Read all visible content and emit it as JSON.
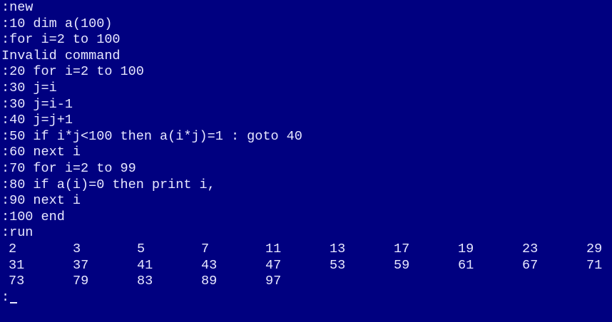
{
  "session": {
    "lines": [
      ":new",
      ":10 dim a(100)",
      ":for i=2 to 100",
      "Invalid command",
      ":20 for i=2 to 100",
      ":30 j=i",
      ":30 j=i-1",
      ":40 j=j+1",
      ":50 if i*j<100 then a(i*j)=1 : goto 40",
      ":60 next i",
      ":70 for i=2 to 99",
      ":80 if a(i)=0 then print i,",
      ":90 next i",
      ":100 end",
      ":run"
    ],
    "output": {
      "row1": [
        "2",
        "3",
        "5",
        "7",
        "11",
        "13",
        "17",
        "19",
        "23",
        "29"
      ],
      "row2": [
        "31",
        "37",
        "41",
        "43",
        "47",
        "53",
        "59",
        "61",
        "67",
        "71"
      ],
      "row3": [
        "73",
        "79",
        "83",
        "89",
        "97"
      ]
    },
    "prompt": ":"
  },
  "colors": {
    "background": "#000080",
    "foreground": "#e8e8ff"
  }
}
